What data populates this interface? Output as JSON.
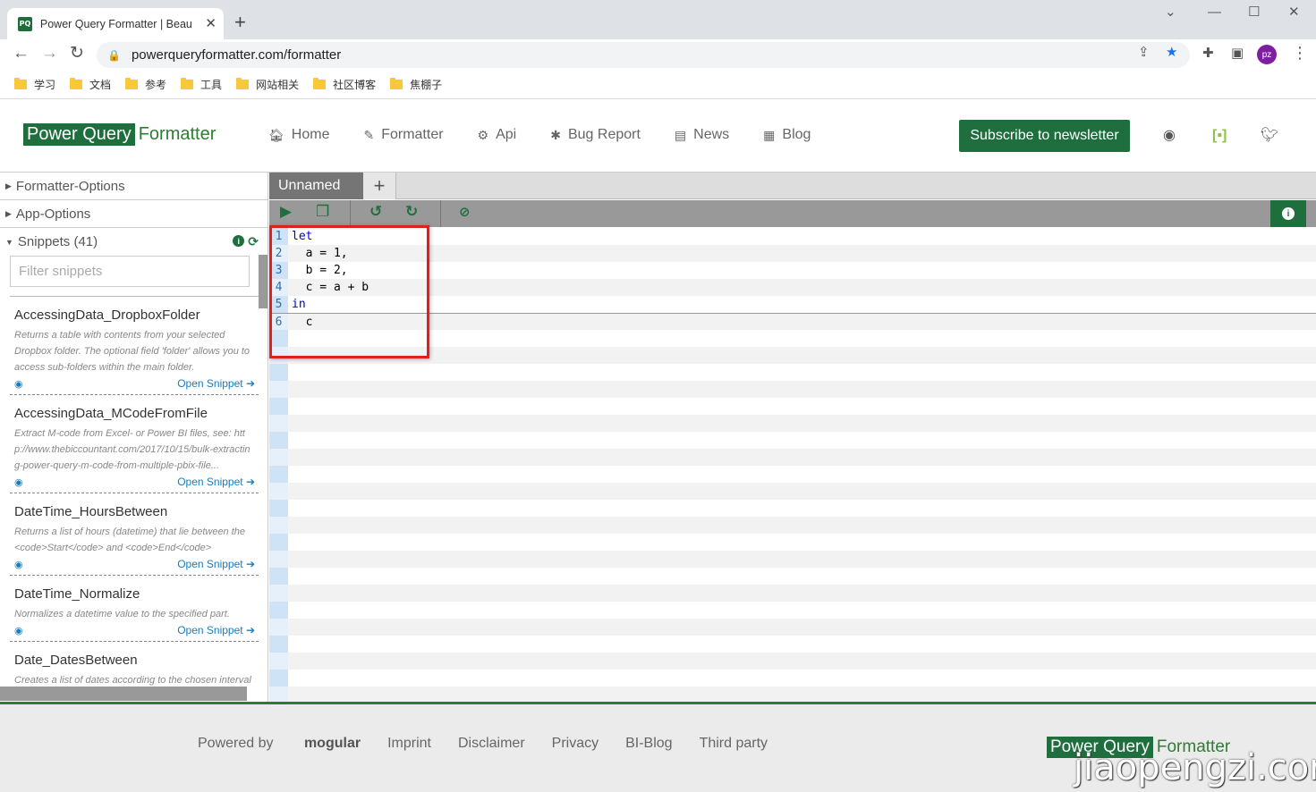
{
  "browser": {
    "tab_title": "Power Query Formatter | Beau",
    "favicon_text": "PQ",
    "url": "powerqueryformatter.com/formatter",
    "profile_initials": "pz",
    "bookmarks": [
      "学习",
      "文档",
      "参考",
      "工具",
      "网站相关",
      "社区博客",
      "焦棚子"
    ]
  },
  "site": {
    "logo_part1": "Power Query",
    "logo_part2": "Formatter",
    "nav": [
      {
        "label": "Home",
        "icon": "home-icon"
      },
      {
        "label": "Formatter",
        "icon": "edit-icon"
      },
      {
        "label": "Api",
        "icon": "cogs-icon"
      },
      {
        "label": "Bug Report",
        "icon": "bug-icon"
      },
      {
        "label": "News",
        "icon": "newspaper-icon"
      },
      {
        "label": "Blog",
        "icon": "blog-icon"
      }
    ],
    "subscribe_label": "Subscribe to newsletter",
    "social": [
      "github-icon",
      "brackets-icon",
      "twitter-icon"
    ]
  },
  "sidebar": {
    "formatter_options": "Formatter-Options",
    "app_options": "App-Options",
    "snippets_label": "Snippets (41)",
    "filter_placeholder": "Filter snippets",
    "open_label": "Open Snippet",
    "snippets": [
      {
        "title": "AccessingData_DropboxFolder",
        "desc": "Returns a table with contents from your selected Dropbox folder. The optional field 'folder' allows you to access sub-folders within the main folder."
      },
      {
        "title": "AccessingData_MCodeFromFile",
        "desc": "Extract M-code from Excel- or Power BI files, see: http://www.thebiccountant.com/2017/10/15/bulk-extracting-power-query-m-code-from-multiple-pbix-file..."
      },
      {
        "title": "DateTime_HoursBetween",
        "desc": "Returns a list of hours (datetime) that lie between the <code>Start</code> and <code>End</code>"
      },
      {
        "title": "DateTime_Normalize",
        "desc": "Normalizes a datetime value to the specified part."
      },
      {
        "title": "Date_DatesBetween",
        "desc": "Creates a list of dates according to the chosen interval between Start and End. The dates created"
      }
    ]
  },
  "editor": {
    "tab_name": "Unnamed",
    "add_tab": "+",
    "lines": [
      {
        "num": "1",
        "text": "let"
      },
      {
        "num": "2",
        "text": "  a = 1,"
      },
      {
        "num": "3",
        "text": "  b = 2,"
      },
      {
        "num": "4",
        "text": "  c = a + b"
      },
      {
        "num": "5",
        "text": "in"
      },
      {
        "num": "6",
        "text": "  c"
      }
    ]
  },
  "footer": {
    "powered_by": "Powered by",
    "powered_brand": "mogular",
    "links": [
      "Imprint",
      "Disclaimer",
      "Privacy",
      "BI-Blog",
      "Third party"
    ],
    "logo_part1": "Power Query",
    "logo_part2": "Formatter",
    "watermark": "jiaopengzi.com"
  },
  "colors": {
    "brand_green": "#1f6e3e",
    "highlight_red": "#e02020",
    "link_blue": "#1a7bc0"
  }
}
